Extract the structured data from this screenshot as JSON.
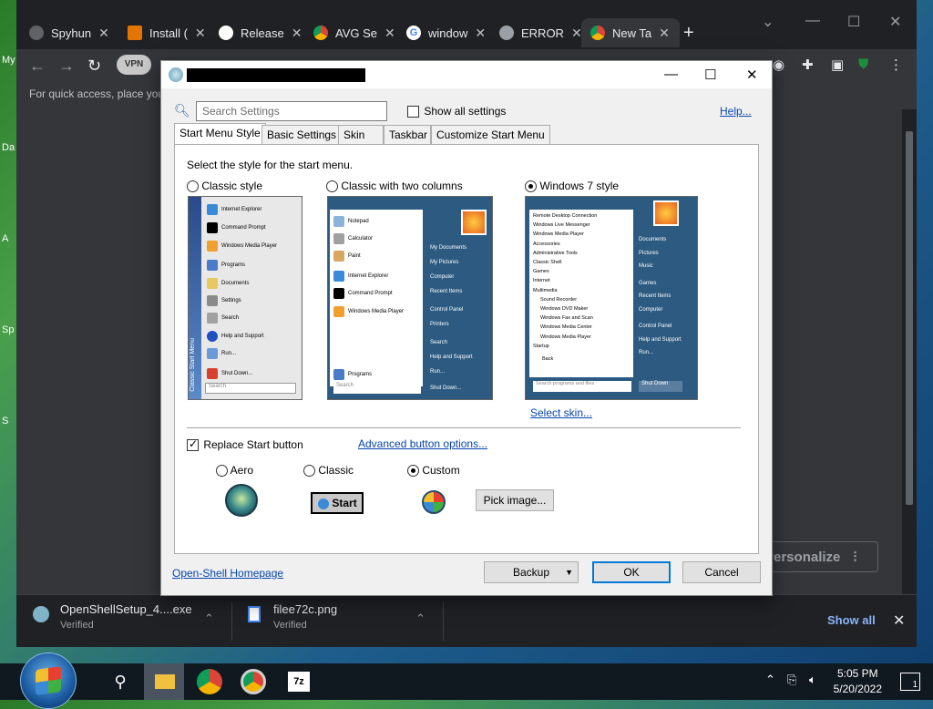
{
  "desktop": {
    "icons": [
      "My",
      "Da",
      "A",
      "Sp",
      "S"
    ]
  },
  "browser": {
    "tabs": [
      {
        "label": "Spyhun",
        "icon_color": "#5f6368"
      },
      {
        "label": "Install (",
        "icon_color": "#e37400"
      },
      {
        "label": "Release",
        "icon_color": "#ffffff"
      },
      {
        "label": "AVG Se",
        "icon_color": "#db4437"
      },
      {
        "label": "window",
        "icon_color": "#4285f4"
      },
      {
        "label": "ERROR",
        "icon_color": "#9aa0a6"
      },
      {
        "label": "New Ta",
        "icon_color": "#db4437"
      }
    ],
    "new_tab": "+",
    "vpn_label": "VPN",
    "bookmarks_text": "For quick access, place you",
    "personalize_label": "Personalize",
    "downloads": [
      {
        "name": "OpenShellSetup_4....exe",
        "status": "Verified"
      },
      {
        "name": "filee72c.png",
        "status": "Verified"
      }
    ],
    "show_all": "Show all"
  },
  "dialog": {
    "search_placeholder": "Search Settings",
    "show_all_settings": "Show all settings",
    "help": "Help...",
    "tabs": [
      "Start Menu Style",
      "Basic Settings",
      "Skin",
      "Taskbar",
      "Customize Start Menu"
    ],
    "prompt": "Select the style for the start menu.",
    "styles": [
      {
        "label": "Classic style",
        "selected": false
      },
      {
        "label": "Classic with two columns",
        "selected": false
      },
      {
        "label": "Windows 7 style",
        "selected": true
      }
    ],
    "classic_items": [
      "Internet Explorer",
      "Command Prompt",
      "Windows Media Player",
      "Programs",
      "Documents",
      "Settings",
      "Search",
      "Help and Support",
      "Run...",
      "Shut Down..."
    ],
    "classic_side": "Classic Start Menu",
    "classic_search": "Search",
    "two_col_left": [
      "Notepad",
      "Calculator",
      "Paint",
      "Internet Explorer",
      "Command Prompt",
      "Windows Media Player"
    ],
    "two_col_programs": "Programs",
    "two_col_right": [
      "My Documents",
      "My Pictures",
      "Computer",
      "Recent Items",
      "Control Panel",
      "Printers",
      "Search",
      "Help and Support",
      "Run...",
      "Shut Down..."
    ],
    "two_col_search": "Search",
    "win7_left": [
      "Remote Desktop Connection",
      "Windows Live Messenger",
      "Windows Media Player",
      "Accessories",
      "Administrative Tools",
      "Classic Shell",
      "Games",
      "Internet",
      "Multimedia",
      "Sound Recorder",
      "Windows DVD Maker",
      "Windows Fax and Scan",
      "Windows Media Center",
      "Windows Media Player",
      "Startup"
    ],
    "win7_back": "Back",
    "win7_right": [
      "Documents",
      "Pictures",
      "Music",
      "Games",
      "Recent Items",
      "Computer",
      "Control Panel",
      "Help and Support",
      "Run..."
    ],
    "win7_search": "Search programs and files",
    "win7_shutdown": "Shut Down",
    "select_skin": "Select skin...",
    "replace_start": {
      "label": "Replace Start button",
      "checked": true
    },
    "advanced_options": "Advanced button options...",
    "button_styles": [
      {
        "label": "Aero",
        "selected": false
      },
      {
        "label": "Classic",
        "selected": false
      },
      {
        "label": "Custom",
        "selected": true
      }
    ],
    "classic_start_label": "Start",
    "pick_image": "Pick image...",
    "homepage": "Open-Shell Homepage",
    "backup": "Backup",
    "ok": "OK",
    "cancel": "Cancel"
  },
  "taskbar": {
    "time": "5:05 PM",
    "date": "5/20/2022",
    "notification_count": "1"
  }
}
